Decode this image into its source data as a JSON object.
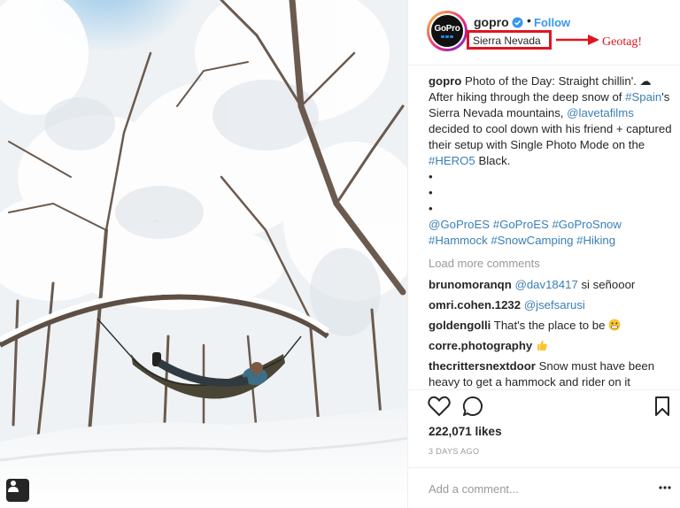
{
  "post": {
    "username": "gopro",
    "follow_label": "Follow",
    "separator": "•",
    "location": "Sierra Nevada",
    "annotation": "Geotag!",
    "avatar_logo": "GoPro",
    "caption": {
      "username": "gopro",
      "text": "Photo of the Day: Straight chillin'. ☁ After hiking through the deep snow of ",
      "tag_spain": "#Spain",
      "text2": "'s Sierra Nevada mountains, ",
      "mention": "@lavetafilms",
      "text3": " decided to cool down with his friend + captured their setup with Single Photo Mode on the ",
      "tag_hero": "#HERO5",
      "text4": " Black.",
      "bullets": [
        "•",
        "•",
        "•"
      ],
      "hashtags_line1": "@GoProES #GoProES #GoProSnow",
      "hashtags_line2": "#Hammock #SnowCamping #Hiking"
    },
    "load_more": "Load more comments",
    "comments": [
      {
        "user": "brunomoranqn",
        "mention": "@dav18417",
        "text": " si señooor"
      },
      {
        "user": "omri.cohen.1232",
        "mention": "@jsefsarusi",
        "text": ""
      },
      {
        "user": "goldengolli",
        "mention": "",
        "text": "That's the place to be"
      },
      {
        "user": "corre.photography",
        "mention": "",
        "text": ""
      },
      {
        "user": "thecrittersnextdoor",
        "mention": "",
        "text": "Snow must have been heavy to get a hammock and rider on it"
      }
    ],
    "likes": "222,071 likes",
    "timestamp": "3 DAYS AGO",
    "comment_placeholder": "Add a comment..."
  },
  "colors": {
    "link_blue": "#3897f0",
    "hashtag_blue": "#3b7fb6",
    "annotation_red": "#e0141e",
    "muted_gray": "#999999"
  },
  "icons": {
    "verified": "verified-badge-icon",
    "like": "heart-icon",
    "comment": "speech-bubble-icon",
    "save": "bookmark-icon",
    "options": "more-dots-icon",
    "user_tags": "person-tag-icon"
  }
}
